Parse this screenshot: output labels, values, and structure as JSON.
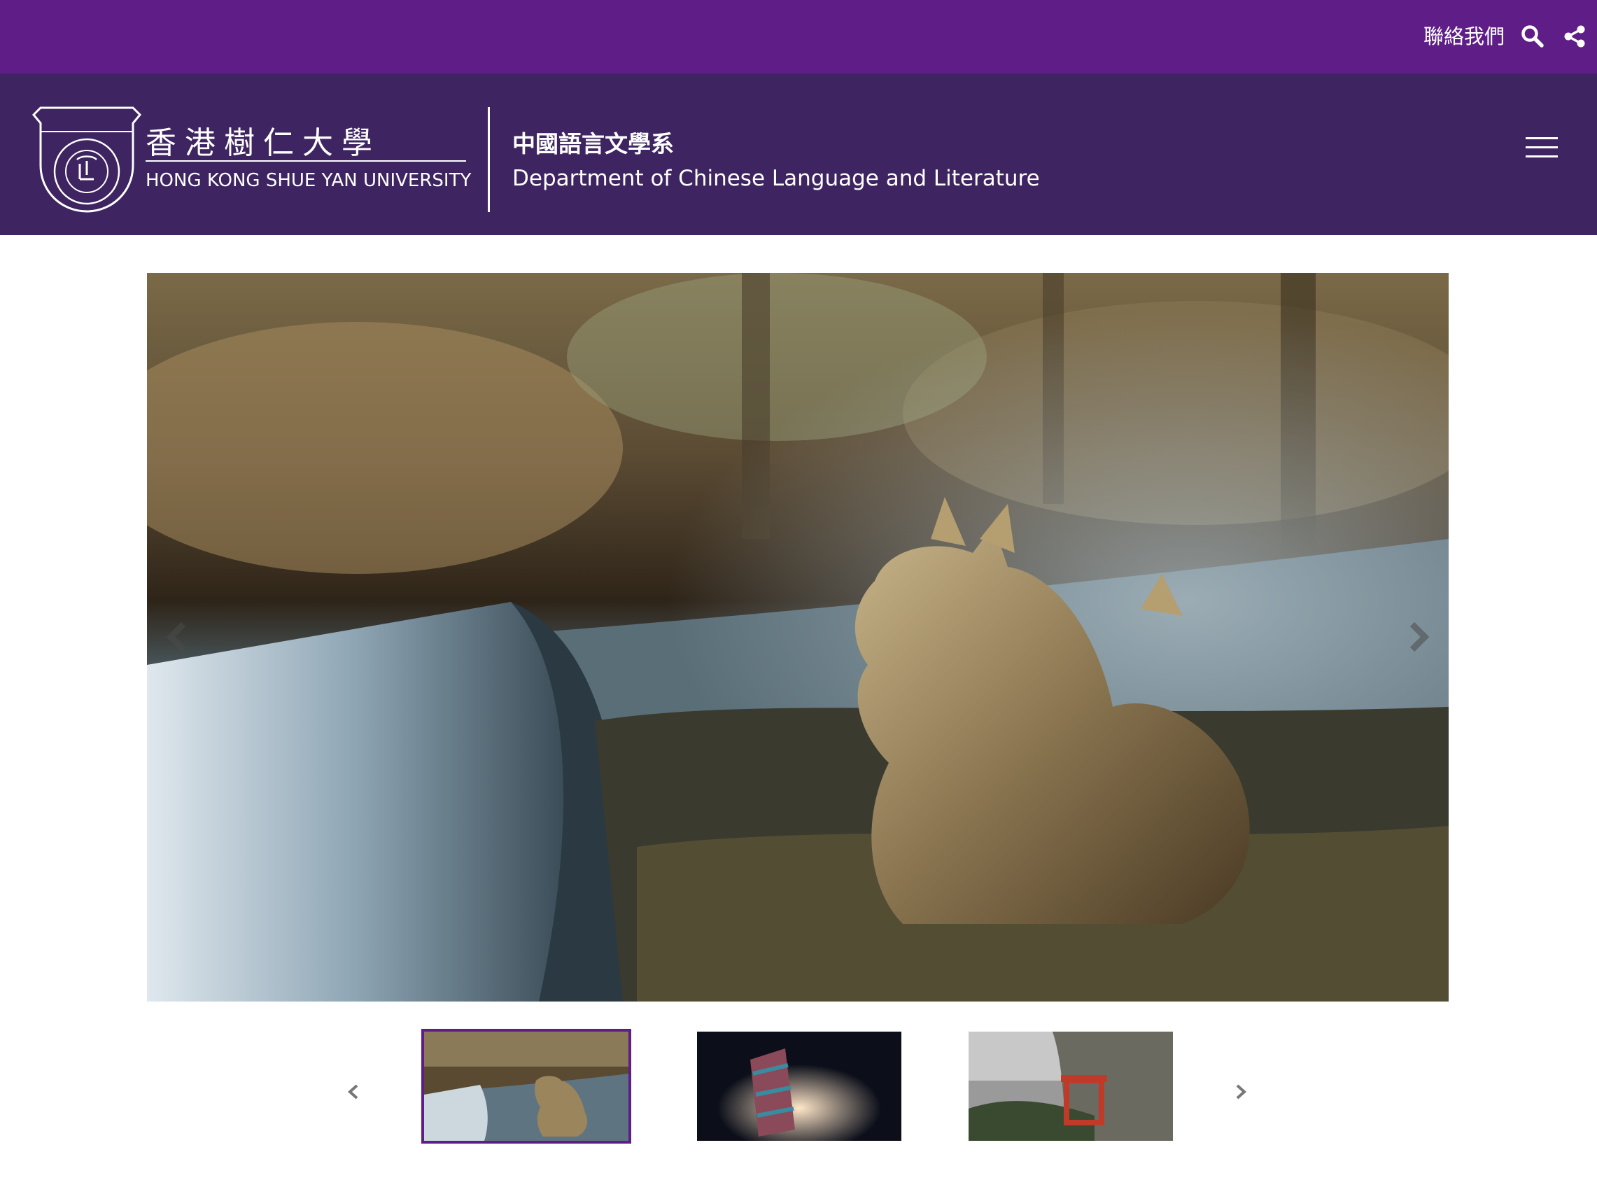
{
  "topbar": {
    "contact_label": "聯絡我們",
    "background": "#5e1d87",
    "icons": [
      "search-icon",
      "share-icon"
    ]
  },
  "header": {
    "background": "#3e2460",
    "logo_text": "樹仁大學",
    "logo_ring_text": "SHUE YAN UNIVERSITY",
    "university_name_zh": "香港樹仁大學",
    "university_name_en": "HONG KONG SHUE YAN UNIVERSITY",
    "department_name_zh": "中國語言文學系",
    "department_name_en": "Department of Chinese Language and Literature",
    "icons": [
      "hamburger-menu-icon"
    ]
  },
  "slideshow": {
    "icons": [
      "chevron-left-icon",
      "chevron-right-icon"
    ],
    "thumbnails": [
      {
        "subject": "dragon figurine at waterfall",
        "active": true
      },
      {
        "subject": "sky lantern at night",
        "active": false
      },
      {
        "subject": "red pavilion on cliff",
        "active": false
      }
    ],
    "accent": "#5e1d87"
  }
}
